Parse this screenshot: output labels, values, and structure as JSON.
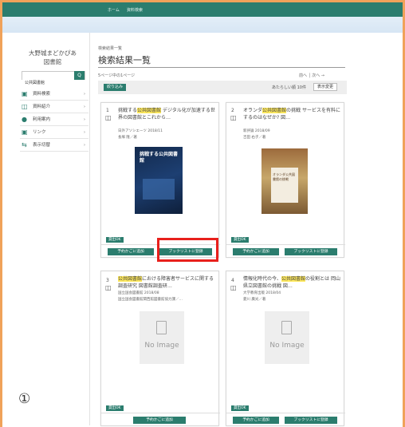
{
  "topbar": {
    "home": "ホーム",
    "search": "資料検索"
  },
  "sidebar": {
    "library_name_line1": "大野城まどかぴあ",
    "library_name_line2": "図書館",
    "search_value": "公共図書館",
    "search_button": "Q",
    "menu": [
      {
        "label": "資料検索",
        "icon": "book-search-icon",
        "glyph": "▣"
      },
      {
        "label": "資料紹介",
        "icon": "open-book-icon",
        "glyph": "◫"
      },
      {
        "label": "利用案内",
        "icon": "person-icon",
        "glyph": "●"
      },
      {
        "label": "リンク",
        "icon": "link-icon",
        "glyph": "▣"
      },
      {
        "label": "表示切替",
        "icon": "toggle-icon",
        "glyph": "⇆"
      }
    ],
    "menu_arrow": "›"
  },
  "main": {
    "breadcrumb": "検索結果一覧",
    "title": "検索結果一覧",
    "page_info": "5ページ中の1ページ",
    "pager": "前へ │ 次へ →",
    "refine_button": "絞り込み",
    "per_page": "あたらしい順 10件",
    "change_button": "表示変更"
  },
  "cards": [
    {
      "num": "1",
      "title_hl": "公共図書館",
      "title_pre": "挑戦する",
      "title_post": " デジタル化が加速する世界の図書館とこれから…",
      "publisher": "日外アソシエーツ 2018/11",
      "author": "長塚 隆／著",
      "cover_label": "挑戦する公共図書館",
      "badge": "貸出OK",
      "reserve": "予約かごに追加",
      "booklist": "ブックリストに登録"
    },
    {
      "num": "2",
      "title_hl": "公共図書館",
      "title_pre": "オランダ",
      "title_post": "の挑戦 サービスを有料にするのはなぜか? 図…",
      "publisher": "新評論 2018/09",
      "author": "吉田 右子／著",
      "cover_label": "オランダ公共図書館の挑戦",
      "badge": "貸出OK",
      "reserve": "予約かごに追加",
      "booklist": "ブックリストに登録"
    },
    {
      "num": "3",
      "title_hl": "公共図書館",
      "title_pre": "",
      "title_post": "における障害者サービスに関する調査研究 図書館調査研…",
      "publisher": "国立国会図書館 2018/08",
      "author": "国立国会図書館関西館図書館協力課／…",
      "no_image": "No Image",
      "badge": "貸出OK",
      "reserve": "予約かごに追加"
    },
    {
      "num": "4",
      "title_hl": "公共図書館",
      "title_pre": "情報化時代の今、",
      "title_post": "の役割とは 岡山県立図書館の挑戦 図…",
      "publisher": "大学教育出版 2018/04",
      "author": "菱川 廣光／著",
      "no_image": "No Image",
      "badge": "貸出OK",
      "reserve": "予約かごに追加",
      "booklist": "ブックリストに登録"
    }
  ],
  "annotation": {
    "circle_number": "①"
  },
  "colors": {
    "frame": "#f0a25a",
    "accent": "#2b7d6e",
    "highlight": "#ffe95c",
    "callout": "#e8201c"
  }
}
